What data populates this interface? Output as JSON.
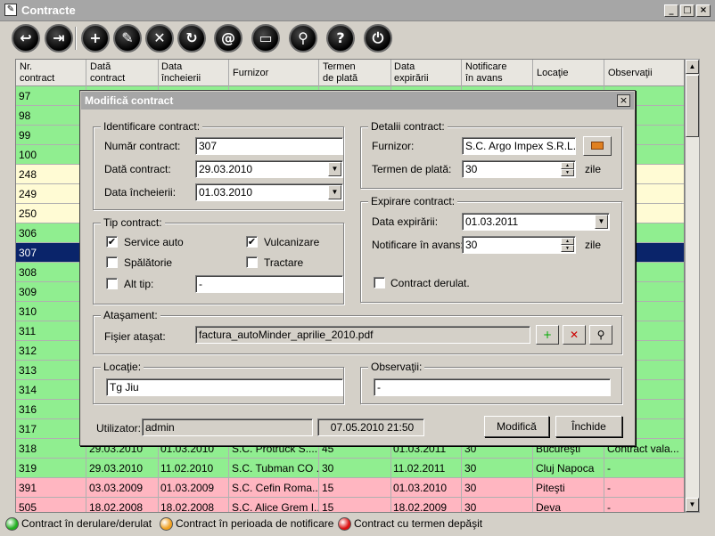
{
  "window": {
    "title": "Contracte"
  },
  "toolbar": {
    "buttons": [
      {
        "name": "back-icon",
        "glyph": "↩"
      },
      {
        "name": "export-icon",
        "glyph": "⇥"
      },
      {
        "name": "add-icon",
        "glyph": "+"
      },
      {
        "name": "edit-icon",
        "glyph": "✎"
      },
      {
        "name": "delete-icon",
        "glyph": "✕"
      },
      {
        "name": "refresh-icon",
        "glyph": "↻"
      },
      {
        "name": "email-icon",
        "glyph": "@"
      },
      {
        "name": "print-icon",
        "glyph": "▭"
      },
      {
        "name": "search-icon",
        "glyph": "⚲"
      },
      {
        "name": "help-icon",
        "glyph": "?"
      },
      {
        "name": "power-icon",
        "glyph": "⏻"
      }
    ]
  },
  "grid": {
    "headers": [
      "Nr.\ncontract",
      "Dată\ncontract",
      "Data\nîncheierii",
      "Furnizor",
      "Termen\nde plată",
      "Data\nexpirării",
      "Notificare\nîn avans",
      "Locaţie",
      "Observaţii"
    ],
    "rows": [
      {
        "status": "green",
        "cells": [
          "97",
          "",
          "",
          "",
          "",
          "",
          "",
          "",
          ""
        ]
      },
      {
        "status": "green",
        "cells": [
          "98",
          "",
          "",
          "",
          "",
          "",
          "",
          "",
          ""
        ]
      },
      {
        "status": "green",
        "cells": [
          "99",
          "",
          "",
          "",
          "",
          "",
          "",
          "",
          ""
        ]
      },
      {
        "status": "green",
        "cells": [
          "100",
          "",
          "",
          "",
          "",
          "",
          "",
          "",
          ""
        ]
      },
      {
        "status": "yellow",
        "cells": [
          "248",
          "",
          "",
          "",
          "",
          "",
          "",
          "",
          ""
        ]
      },
      {
        "status": "yellow",
        "cells": [
          "249",
          "",
          "",
          "",
          "",
          "",
          "",
          "",
          ""
        ]
      },
      {
        "status": "yellow",
        "cells": [
          "250",
          "",
          "",
          "",
          "",
          "",
          "",
          "",
          ""
        ]
      },
      {
        "status": "green",
        "cells": [
          "306",
          "",
          "",
          "",
          "",
          "",
          "",
          "",
          ""
        ]
      },
      {
        "status": "sel",
        "cells": [
          "307",
          "",
          "",
          "",
          "",
          "",
          "",
          "",
          ""
        ]
      },
      {
        "status": "green",
        "cells": [
          "308",
          "",
          "",
          "",
          "",
          "",
          "",
          "",
          ""
        ]
      },
      {
        "status": "green",
        "cells": [
          "309",
          "",
          "",
          "",
          "",
          "",
          "",
          "",
          ""
        ]
      },
      {
        "status": "green",
        "cells": [
          "310",
          "",
          "",
          "",
          "",
          "",
          "",
          "",
          ""
        ]
      },
      {
        "status": "green",
        "cells": [
          "311",
          "",
          "",
          "",
          "",
          "",
          "",
          "",
          ""
        ]
      },
      {
        "status": "green",
        "cells": [
          "312",
          "",
          "",
          "",
          "",
          "",
          "",
          "",
          ""
        ]
      },
      {
        "status": "green",
        "cells": [
          "313",
          "",
          "",
          "",
          "",
          "",
          "",
          "",
          ""
        ]
      },
      {
        "status": "green",
        "cells": [
          "314",
          "",
          "",
          "",
          "",
          "",
          "",
          "",
          ""
        ]
      },
      {
        "status": "green",
        "cells": [
          "316",
          "",
          "",
          "",
          "",
          "",
          "",
          "",
          ""
        ]
      },
      {
        "status": "green",
        "cells": [
          "317",
          "",
          "",
          "",
          "",
          "",
          "",
          "",
          ""
        ]
      },
      {
        "status": "green",
        "cells": [
          "318",
          "29.03.2010",
          "01.03.2010",
          "S.C. Protruck S....",
          "45",
          "01.03.2011",
          "30",
          "Bucureşti",
          "Contract vala..."
        ]
      },
      {
        "status": "green",
        "cells": [
          "319",
          "29.03.2010",
          "11.02.2010",
          "S.C. Tubman CO ...",
          "30",
          "11.02.2011",
          "30",
          "Cluj Napoca",
          "-"
        ]
      },
      {
        "status": "pink",
        "cells": [
          "391",
          "03.03.2009",
          "01.03.2009",
          "S.C. Cefin Roma...",
          "15",
          "01.03.2010",
          "30",
          "Piteşti",
          "-"
        ]
      },
      {
        "status": "pink",
        "cells": [
          "505",
          "18.02.2008",
          "18.02.2008",
          "S.C. Alice Grem I...",
          "15",
          "18.02.2009",
          "30",
          "Deva",
          "-"
        ]
      }
    ]
  },
  "legend": [
    {
      "color": "#22b022",
      "text": "Contract în derulare/derulat"
    },
    {
      "color": "#f0a020",
      "text": "Contract în perioada de notificare"
    },
    {
      "color": "#dd1111",
      "text": "Contract cu termen depăşit"
    }
  ],
  "dialog": {
    "title": "Modifică contract",
    "ident": {
      "caption": "Identificare contract:",
      "nr_label": "Număr contract:",
      "nr_value": "307",
      "data_label": "Dată contract:",
      "data_value": "29.03.2010",
      "inch_label": "Data încheierii:",
      "inch_value": "01.03.2010"
    },
    "tip": {
      "caption": "Tip contract:",
      "service": "Service auto",
      "vulcanizare": "Vulcanizare",
      "spalatorie": "Spălătorie",
      "tractare": "Tractare",
      "alt": "Alt tip:",
      "alt_value": "-",
      "check": "✔"
    },
    "detalii": {
      "caption": "Detalii contract:",
      "furnizor_label": "Furnizor:",
      "furnizor_value": "S.C. Argo Impex S.R.L.",
      "termen_label": "Termen de plată:",
      "termen_value": "30",
      "zile": "zile"
    },
    "expirare": {
      "caption": "Expirare contract:",
      "data_label": "Data expirării:",
      "data_value": "01.03.2011",
      "notif_label": "Notificare în avans:",
      "notif_value": "30",
      "zile": "zile",
      "derulat": "Contract derulat."
    },
    "atasament": {
      "caption": "Ataşament:",
      "fisier_label": "Fişier ataşat:",
      "fisier_value": "factura_autoMinder_aprilie_2010.pdf"
    },
    "locatie": {
      "caption": "Locaţie:",
      "value": "Tg Jiu"
    },
    "observatii": {
      "caption": "Observaţii:",
      "value": "-"
    },
    "footer": {
      "user_label": "Utilizator:",
      "user_value": "admin",
      "datetime": "07.05.2010 21:50",
      "modifica": "Modifică",
      "inchide": "Închide"
    }
  }
}
